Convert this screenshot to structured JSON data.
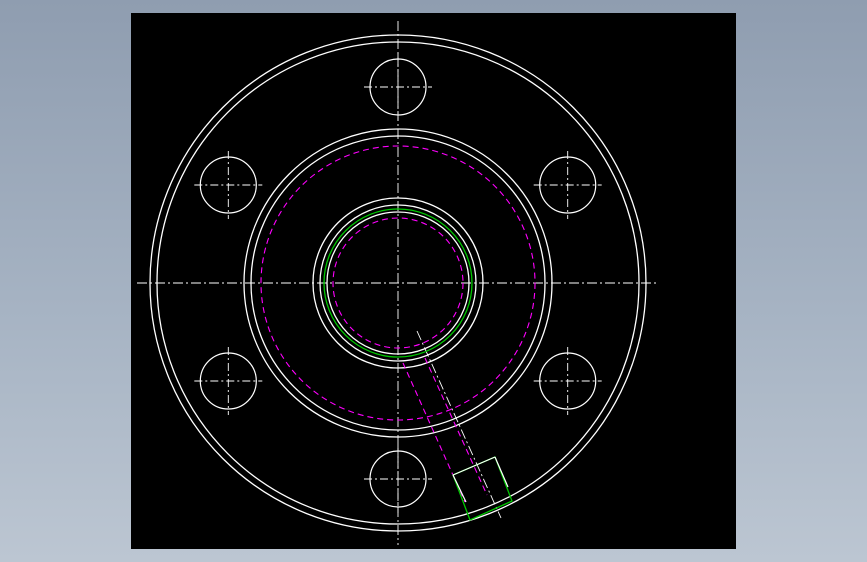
{
  "drawing": {
    "background_color": "#000000",
    "outline_color": "#ffffff",
    "hidden_line_color": "#ff00ff",
    "thread_color": "#00c800",
    "centerline_color": "#ffffff"
  }
}
